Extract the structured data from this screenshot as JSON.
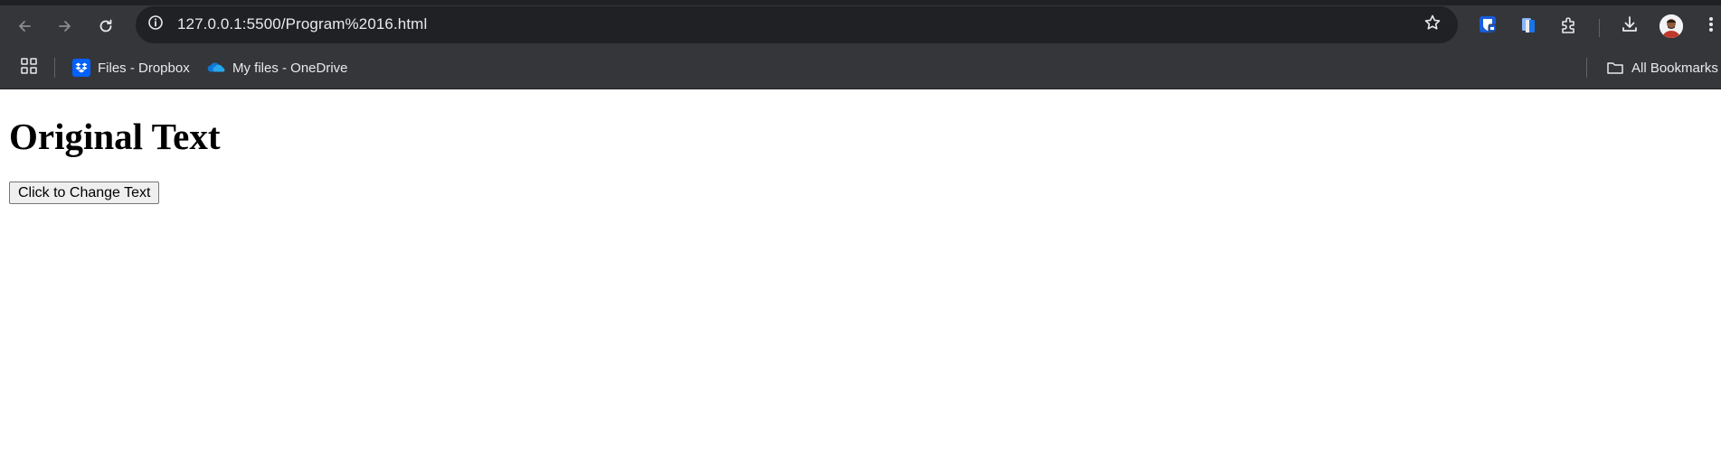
{
  "browser": {
    "url": "127.0.0.1:5500/Program%2016.html",
    "nav": {
      "back_icon": "arrow-left-icon",
      "forward_icon": "arrow-right-icon",
      "reload_icon": "reload-icon"
    },
    "omnibox": {
      "site_info_icon": "info-icon",
      "bookmark_star_icon": "star-icon"
    },
    "toolbar_icons": [
      "bitwarden-icon",
      "docs-extension-icon",
      "extensions-puzzle-icon",
      "download-icon",
      "avatar",
      "more-vert-icon"
    ],
    "colors": {
      "chrome_bg": "#35363a",
      "omnibox_bg": "#202124",
      "text": "#e8eaed",
      "dropbox_blue": "#0061fe",
      "onedrive_blue": "#0f78d4"
    }
  },
  "bookmarks": {
    "apps_icon": "apps-grid-icon",
    "items": [
      {
        "label": "Files - Dropbox",
        "icon": "dropbox-icon"
      },
      {
        "label": "My files - OneDrive",
        "icon": "onedrive-icon"
      }
    ],
    "all_bookmarks": {
      "label": "All Bookmarks",
      "icon": "folder-icon"
    }
  },
  "page": {
    "heading": "Original Text",
    "button_label": "Click to Change Text"
  }
}
